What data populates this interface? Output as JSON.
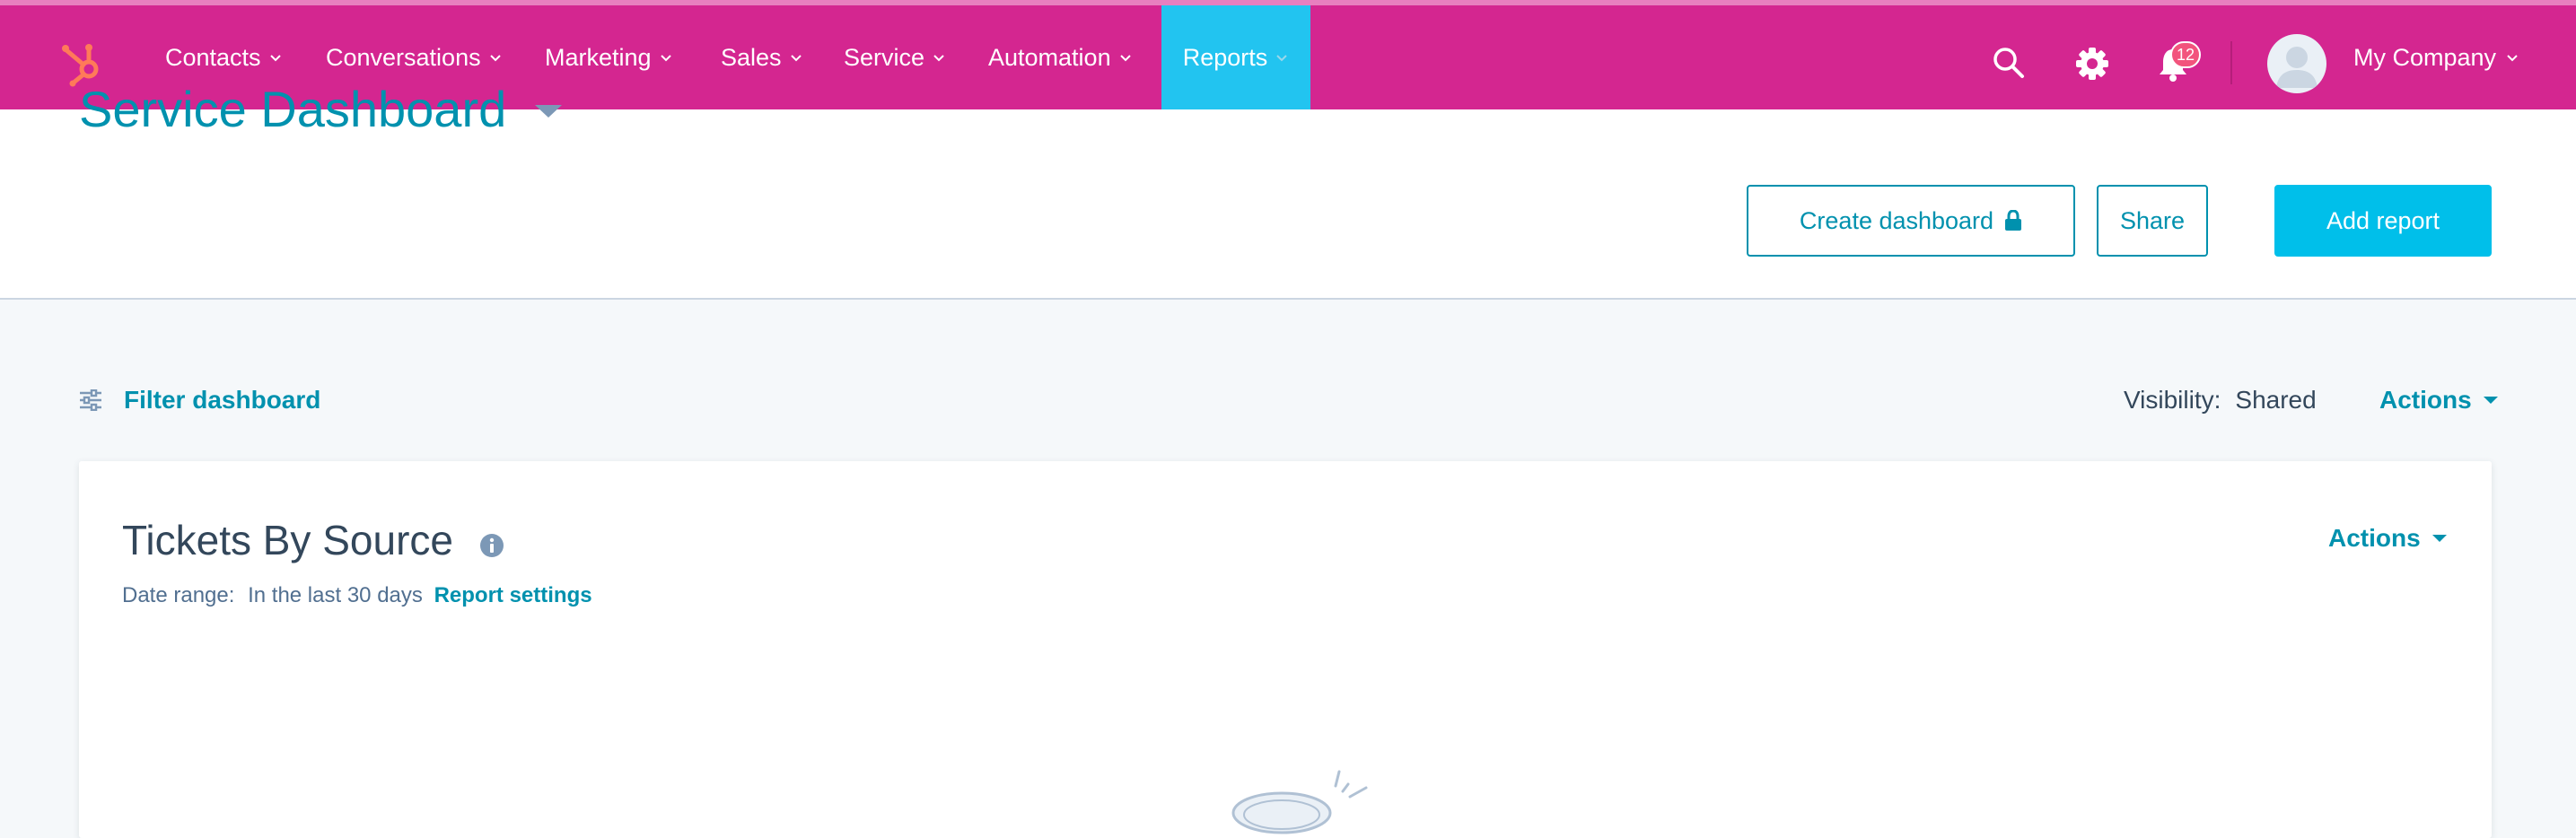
{
  "nav": {
    "items": [
      {
        "label": "Contacts"
      },
      {
        "label": "Conversations"
      },
      {
        "label": "Marketing"
      },
      {
        "label": "Sales"
      },
      {
        "label": "Service"
      },
      {
        "label": "Automation"
      },
      {
        "label": "Reports",
        "active": true
      }
    ],
    "notification_count": "12",
    "account_label": "My Company",
    "icons": [
      "sprocket-logo-icon",
      "search-icon",
      "gear-icon",
      "bell-icon",
      "avatar-icon",
      "chevron-down-icon"
    ]
  },
  "header": {
    "title": "Service Dashboard",
    "buttons": {
      "create_dashboard": "Create dashboard",
      "share": "Share",
      "add_report": "Add report"
    }
  },
  "toolbar": {
    "filter_label": "Filter dashboard",
    "visibility_label": "Visibility:",
    "visibility_value": "Shared",
    "actions_label": "Actions"
  },
  "report": {
    "title": "Tickets By Source",
    "date_range_label": "Date range:",
    "date_range_value": "In the last 30 days",
    "settings_link": "Report settings",
    "actions_label": "Actions"
  },
  "colors": {
    "nav_background": "#d42690",
    "nav_active": "#22c4f0",
    "accent": "#0091ae",
    "primary_button": "#00bfea",
    "badge": "#f2547d",
    "logo": "#ff7a59"
  }
}
